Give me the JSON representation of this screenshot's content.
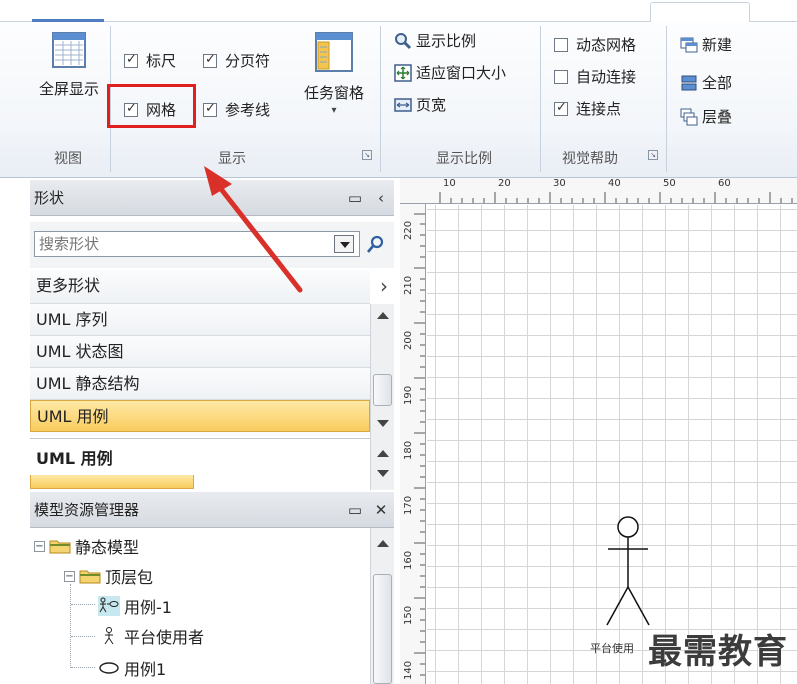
{
  "ribbon": {
    "groups": {
      "view": {
        "label": "视图",
        "full_screen": "全屏显示"
      },
      "show": {
        "label": "显示",
        "ruler": {
          "label": "标尺",
          "checked": true
        },
        "page_breaks": {
          "label": "分页符",
          "checked": true
        },
        "grid": {
          "label": "网格",
          "checked": true
        },
        "guides": {
          "label": "参考线",
          "checked": true
        },
        "task_panes": "任务窗格"
      },
      "zoom": {
        "label": "显示比例",
        "zoom": "显示比例",
        "fit_window": "适应窗口大小",
        "page_width": "页宽"
      },
      "visual_aids": {
        "label": "视觉帮助",
        "dynamic_grid": {
          "label": "动态网格",
          "checked": false
        },
        "auto_connect": {
          "label": "自动连接",
          "checked": false
        },
        "connection_points": {
          "label": "连接点",
          "checked": true
        }
      },
      "window": {
        "new_window": "新建",
        "arrange_all": "全部",
        "cascade": "层叠"
      }
    }
  },
  "shapes_pane": {
    "title": "形状",
    "search_placeholder": "搜索形状",
    "more_shapes": "更多形状",
    "stencils": [
      {
        "label": "UML 序列",
        "selected": false
      },
      {
        "label": "UML 状态图",
        "selected": false
      },
      {
        "label": "UML 静态结构",
        "selected": false
      },
      {
        "label": "UML 用例",
        "selected": true
      }
    ],
    "active_stencil_title": "UML 用例"
  },
  "model_explorer": {
    "title": "模型资源管理器",
    "items": [
      {
        "label": "静态模型",
        "level": 0
      },
      {
        "label": "顶层包",
        "level": 1
      },
      {
        "label": "用例-1",
        "level": 2
      },
      {
        "label": "平台使用者",
        "level": 2
      },
      {
        "label": "用例1",
        "level": 2
      }
    ]
  },
  "drawing": {
    "ruler_x": [
      "10",
      "20",
      "30",
      "40",
      "50",
      "60"
    ],
    "ruler_y": [
      "220",
      "210",
      "200",
      "190",
      "180",
      "170",
      "160",
      "150",
      "140"
    ],
    "actor_caption": "平台使用"
  },
  "watermark": "最需教育",
  "colors": {
    "highlight": "#e02020",
    "selected_stencil": "#f8cc5e",
    "accent": "#4f7cc2"
  }
}
